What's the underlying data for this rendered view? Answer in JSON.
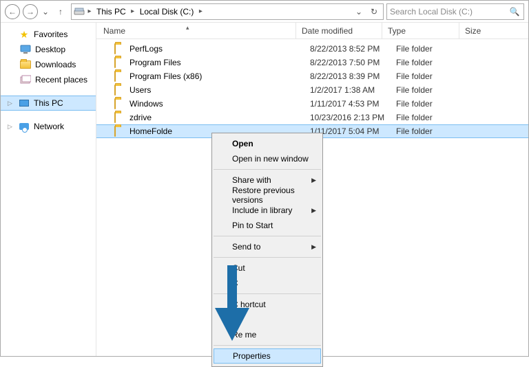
{
  "breadcrumbs": {
    "root": "This PC",
    "drive": "Local Disk (C:)"
  },
  "search_placeholder": "Search Local Disk (C:)",
  "sidebar": {
    "favorites": {
      "label": "Favorites",
      "items": [
        {
          "label": "Desktop"
        },
        {
          "label": "Downloads"
        },
        {
          "label": "Recent places"
        }
      ]
    },
    "this_pc": "This PC",
    "network": "Network"
  },
  "columns": {
    "name": "Name",
    "date": "Date modified",
    "type": "Type",
    "size": "Size"
  },
  "rows": [
    {
      "name": "PerfLogs",
      "date": "8/22/2013 8:52 PM",
      "type": "File folder"
    },
    {
      "name": "Program Files",
      "date": "8/22/2013 7:50 PM",
      "type": "File folder"
    },
    {
      "name": "Program Files (x86)",
      "date": "8/22/2013 8:39 PM",
      "type": "File folder"
    },
    {
      "name": "Users",
      "date": "1/2/2017 1:38 AM",
      "type": "File folder"
    },
    {
      "name": "Windows",
      "date": "1/11/2017 4:53 PM",
      "type": "File folder"
    },
    {
      "name": "zdrive",
      "date": "10/23/2016 2:13 PM",
      "type": "File folder"
    },
    {
      "name": "HomeFolde",
      "date": "1/11/2017 5:04 PM",
      "type": "File folder",
      "selected": true
    }
  ],
  "context_menu": {
    "groups": [
      [
        {
          "label": "Open",
          "bold": true
        },
        {
          "label": "Open in new window"
        }
      ],
      [
        {
          "label": "Share with",
          "submenu": true
        },
        {
          "label": "Restore previous versions"
        },
        {
          "label": "Include in library",
          "submenu": true
        },
        {
          "label": "Pin to Start"
        }
      ],
      [
        {
          "label": "Send to",
          "submenu": true
        }
      ],
      [
        {
          "label": "Cut"
        },
        {
          "label": "C"
        }
      ],
      [
        {
          "label": "C          hortcut"
        },
        {
          "label": "D"
        },
        {
          "label": "Re        me"
        }
      ],
      [
        {
          "label": "Properties",
          "highlight": true
        }
      ]
    ]
  }
}
